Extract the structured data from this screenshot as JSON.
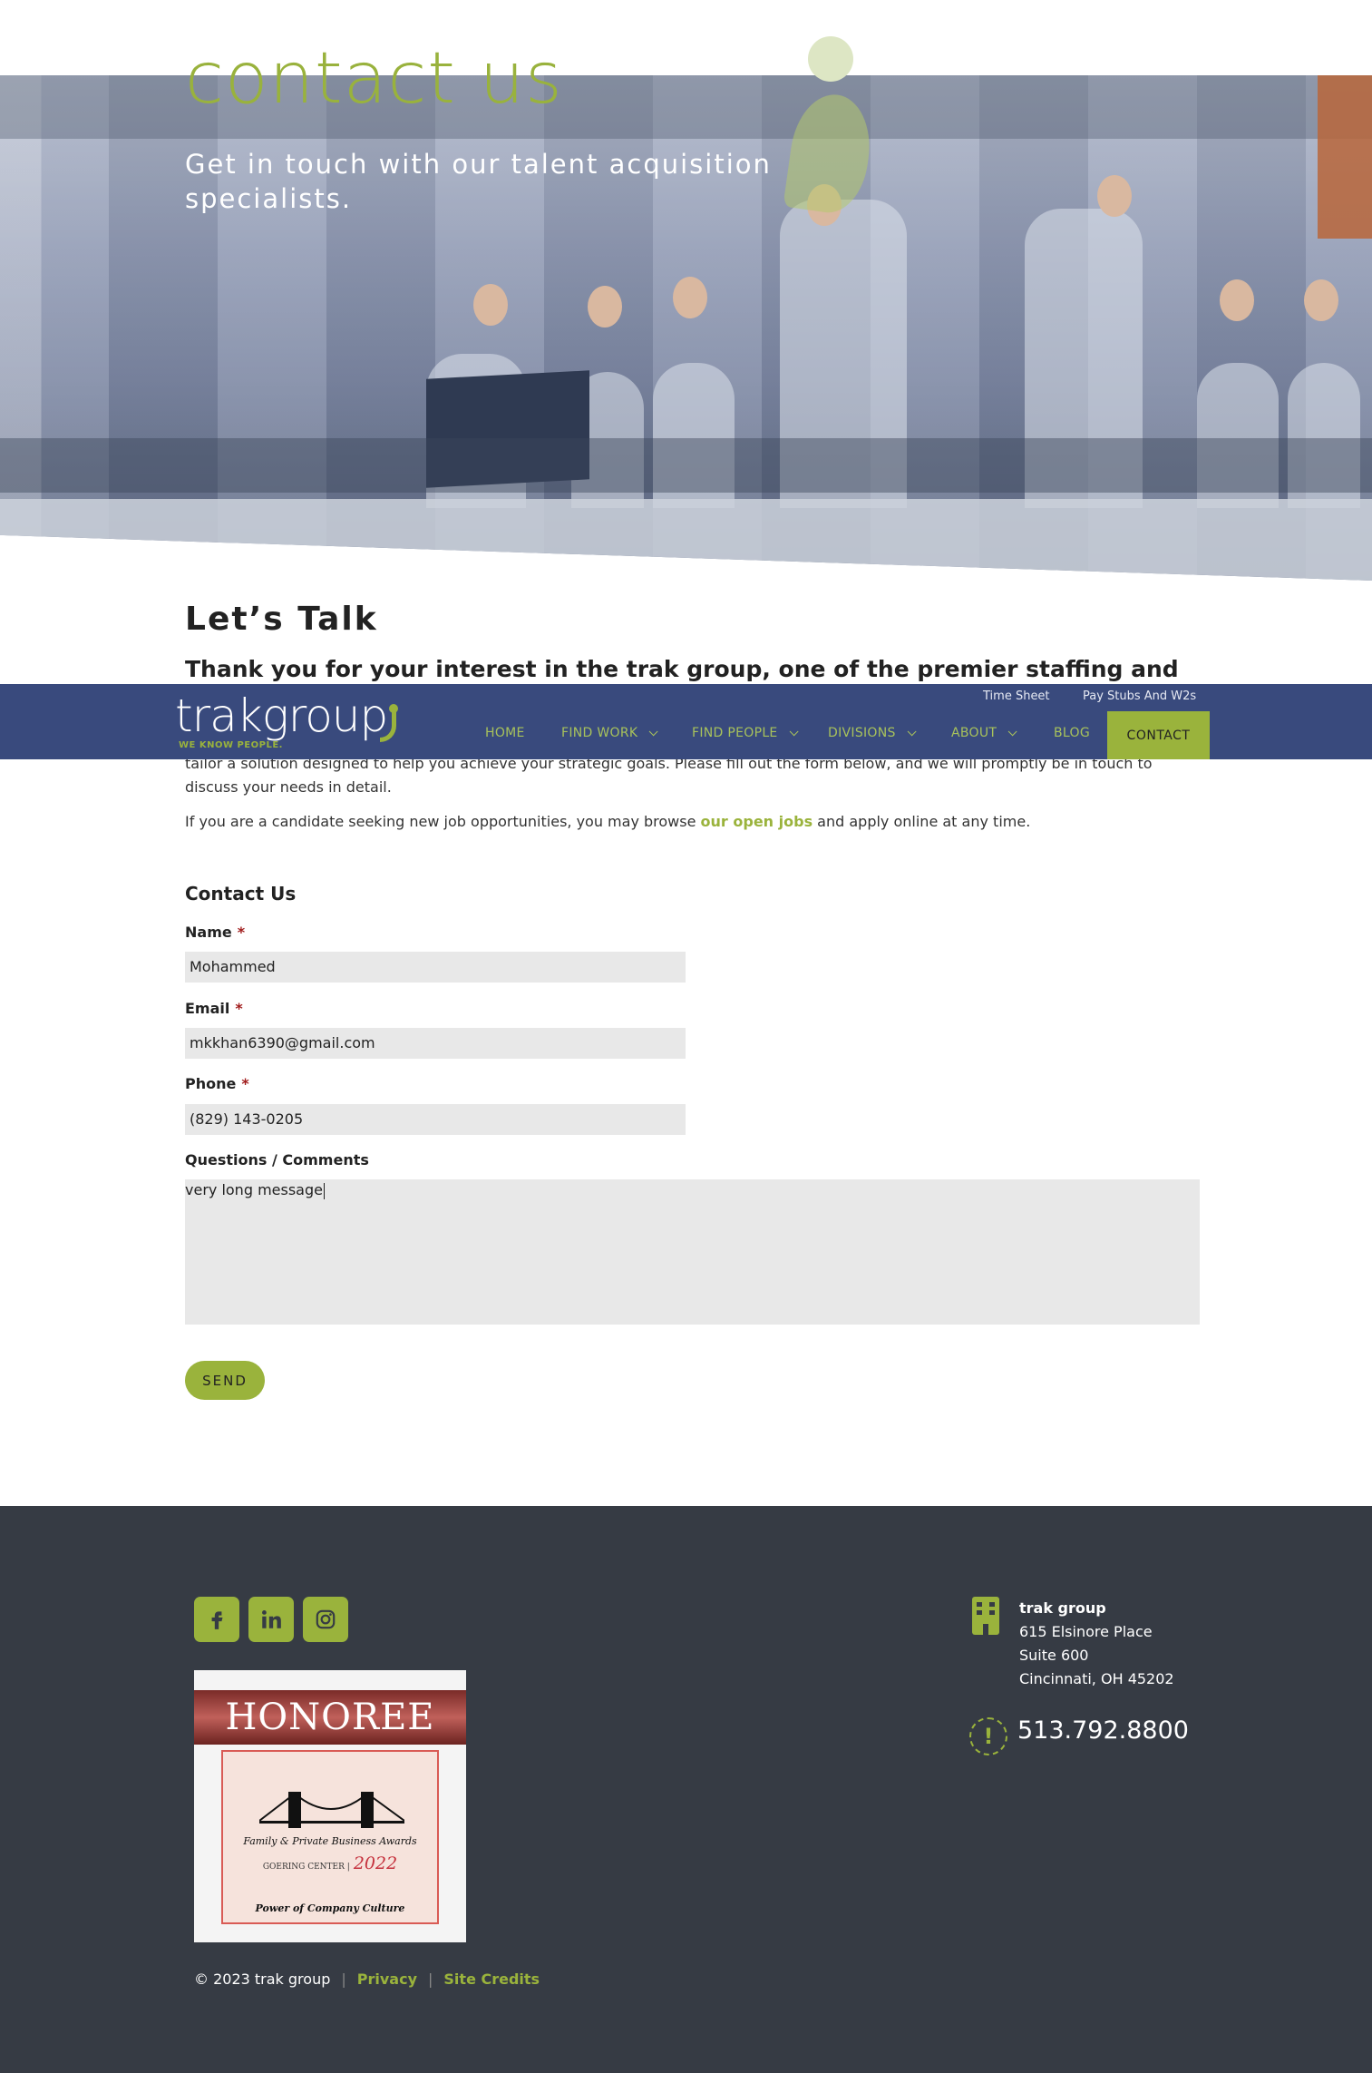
{
  "hero": {
    "title": "contact us",
    "subtitle": "Get in touch with our talent acquisition specialists."
  },
  "intro": {
    "heading": "Let’s Talk",
    "lead": "Thank you for your interest in the trak group, one of the premier staffing and recruiting",
    "continued": "tailor a solution designed to help you achieve your strategic goals. Please fill out the form below, and we will promptly be in touch to discuss your needs in detail.",
    "candidate_before": "If you are a candidate seeking new job opportunities, you may browse ",
    "candidate_link": "our open jobs",
    "candidate_after": " and apply online at any time."
  },
  "navbar": {
    "logo_text": "trakgroup",
    "logo_tagline": "WE KNOW PEOPLE.",
    "utility_links": [
      "Time Sheet",
      "Pay Stubs And W2s"
    ],
    "items": [
      {
        "label": "HOME"
      },
      {
        "label": "FIND WORK"
      },
      {
        "label": "FIND PEOPLE"
      },
      {
        "label": "DIVISIONS"
      },
      {
        "label": "ABOUT"
      },
      {
        "label": "BLOG"
      },
      {
        "label": "CONTACT"
      }
    ]
  },
  "form": {
    "title": "Contact Us",
    "required_mark": "*",
    "name_label": "Name",
    "name_value": "Mohammed",
    "email_label": "Email",
    "email_value": "mkkhan6390@gmail.com",
    "phone_label": "Phone",
    "phone_value": "(829) 143-0205",
    "comments_label": "Questions / Comments",
    "comments_value": "very long message",
    "send_label": "SEND"
  },
  "footer": {
    "social": [
      "facebook-icon",
      "linkedin-icon",
      "instagram-icon"
    ],
    "award": {
      "banner": "HONOREE",
      "line1": "Family & Private Business Awards",
      "center_name": "GOERING CENTER",
      "year": "2022",
      "category": "Power of Company Culture"
    },
    "copyright": "© 2023 trak group",
    "privacy": "Privacy",
    "credits": "Site Credits",
    "separator": "|",
    "address": {
      "name": "trak group",
      "line1": "615 Elsinore Place",
      "line2": "Suite 600",
      "line3": "Cincinnati, OH 45202"
    },
    "phone": "513.792.8800"
  },
  "colors": {
    "accent_green": "#9ab33c",
    "nav_blue": "#394a7d",
    "footer_bg": "#363b44"
  }
}
